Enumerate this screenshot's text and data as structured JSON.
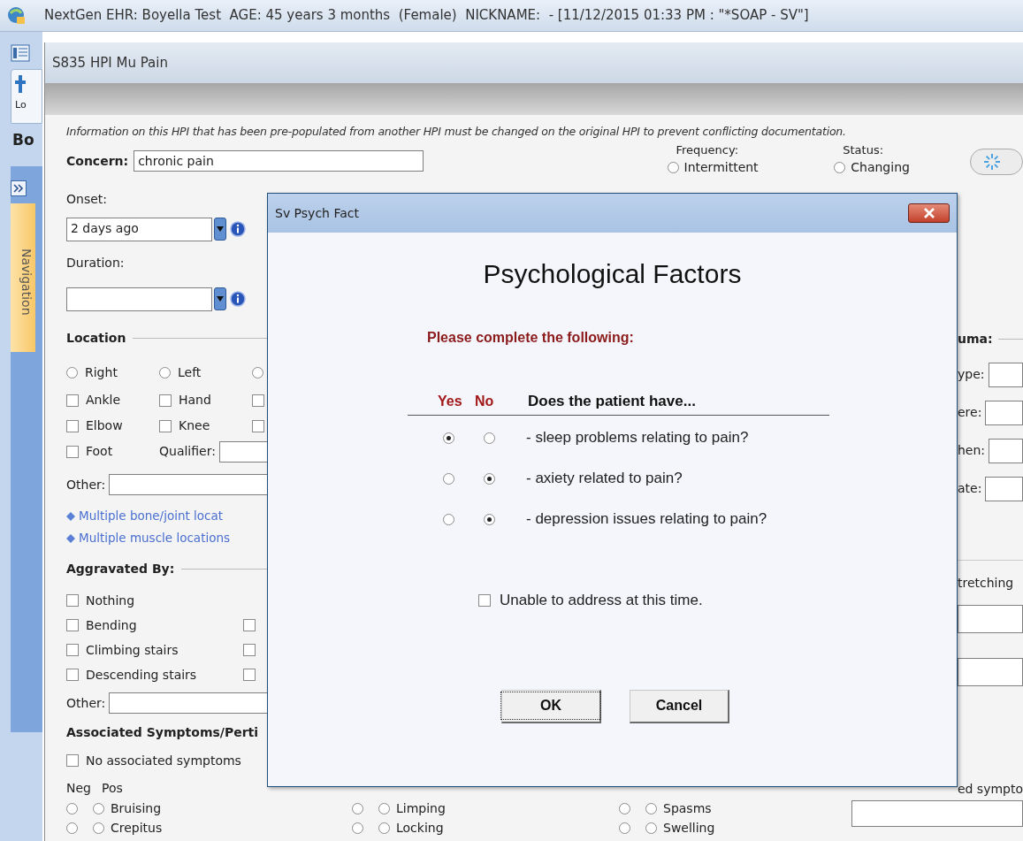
{
  "window": {
    "title": "NextGen EHR: Boyella Test  AGE: 45 years 3 months  (Female)  NICKNAME:  - [11/12/2015 01:33 PM : \"*SOAP - SV\"]"
  },
  "rail": {
    "tab_label": "Lo",
    "heading": "Bo",
    "nav_label": "Navigation"
  },
  "form": {
    "title": "S835 HPI Mu Pain",
    "notice": "Information on this HPI that has been pre-populated from another HPI must be changed on the original HPI to prevent conflicting documentation.",
    "concern": {
      "label": "Concern:",
      "value": "chronic pain"
    },
    "frequency": {
      "label": "Frequency:",
      "options": [
        {
          "label": "Intermittent",
          "selected": false
        }
      ]
    },
    "status": {
      "label": "Status:",
      "options": [
        {
          "label": "Changing",
          "selected": false
        }
      ]
    },
    "onset": {
      "label": "Onset:",
      "value": "2 days ago"
    },
    "duration": {
      "label": "Duration:"
    },
    "location": {
      "heading": "Location",
      "sides": [
        {
          "label": "Right",
          "selected": false
        },
        {
          "label": "Left",
          "selected": false
        },
        {
          "selected": false
        }
      ],
      "rows": [
        [
          {
            "label": "Ankle",
            "checked": false
          },
          {
            "label": "Hand",
            "checked": false
          },
          {
            "checked": false
          }
        ],
        [
          {
            "label": "Elbow",
            "checked": false
          },
          {
            "label": "Knee",
            "checked": false
          },
          {
            "checked": false
          }
        ],
        [
          {
            "label": "Foot",
            "checked": false
          }
        ]
      ],
      "qualifier_label": "Qualifier:",
      "other_label": "Other:",
      "links": [
        "Multiple bone/joint locat",
        "Multiple muscle locations"
      ]
    },
    "aggravated": {
      "heading": "Aggravated By:",
      "rows": [
        [
          {
            "label": "Nothing",
            "checked": false
          }
        ],
        [
          {
            "label": "Bending",
            "checked": false
          },
          {
            "checked": false
          }
        ],
        [
          {
            "label": "Climbing stairs",
            "checked": false
          },
          {
            "checked": false
          }
        ],
        [
          {
            "label": "Descending stairs",
            "checked": false
          },
          {
            "checked": false
          }
        ]
      ],
      "other_label": "Other:"
    },
    "associated": {
      "heading": "Associated Symptoms/Perti",
      "none": {
        "label": "No associated symptoms",
        "checked": false
      },
      "columns_header": [
        "Neg",
        "Pos"
      ],
      "columns": [
        [
          {
            "label": "Bruising",
            "neg": false,
            "pos": false
          },
          {
            "label": "Crepitus",
            "neg": false,
            "pos": false
          }
        ],
        [
          {
            "label": "Limping",
            "neg": false,
            "pos": false
          },
          {
            "label": "Locking",
            "neg": false,
            "pos": false
          }
        ],
        [
          {
            "label": "Spasms",
            "neg": false,
            "pos": false
          },
          {
            "label": "Swelling",
            "neg": false,
            "pos": false
          }
        ]
      ],
      "side_label": "ed sympto"
    },
    "right_strip": {
      "heading": "uma:",
      "field_labels": [
        "ype:",
        "ere:",
        "hen:",
        "ate:"
      ],
      "note": "tretching"
    }
  },
  "dialog": {
    "title": "Sv Psych Fact",
    "heading": "Psychological Factors",
    "prompt": "Please complete the following:",
    "yes_label": "Yes",
    "no_label": "No",
    "question": "Does the patient have...",
    "rows": [
      {
        "text": "- sleep problems relating to pain?",
        "yes": true,
        "no": false
      },
      {
        "text": "- axiety related to pain?",
        "yes": false,
        "no": true
      },
      {
        "text": "- depression issues relating to pain?",
        "yes": false,
        "no": true
      }
    ],
    "unable": {
      "label": "Unable to address at this time.",
      "checked": false
    },
    "buttons": [
      {
        "label": "OK",
        "focused": true
      },
      {
        "label": "Cancel",
        "focused": false
      }
    ]
  }
}
